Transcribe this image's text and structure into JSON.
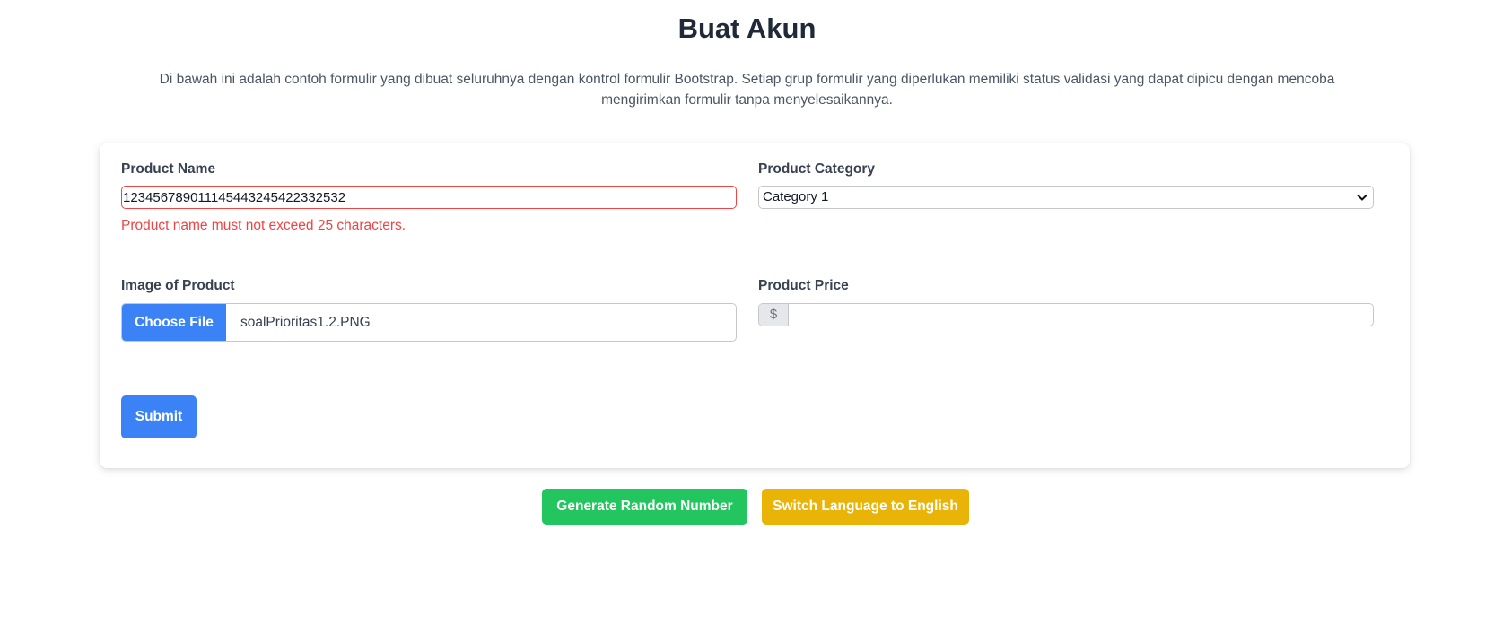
{
  "header": {
    "title": "Buat Akun",
    "description": "Di bawah ini adalah contoh formulir yang dibuat seluruhnya dengan kontrol formulir Bootstrap. Setiap grup formulir yang diperlukan memiliki status validasi yang dapat dipicu dengan mencoba mengirimkan formulir tanpa menyelesaikannya."
  },
  "form": {
    "product_name": {
      "label": "Product Name",
      "value": "12345678901114544324542233253​2",
      "error": "Product name must not exceed 25 characters."
    },
    "product_category": {
      "label": "Product Category",
      "selected": "Category 1"
    },
    "image": {
      "label": "Image of Product",
      "button_label": "Choose File",
      "file_name": "soalPrioritas1.2.PNG"
    },
    "price": {
      "label": "Product Price",
      "prefix": "$",
      "value": ""
    },
    "submit_label": "Submit"
  },
  "actions": {
    "generate_label": "Generate Random Number",
    "switch_language_label": "Switch Language to English"
  },
  "colors": {
    "primary": "#3b82f6",
    "success": "#22c55e",
    "warning": "#eab308",
    "danger": "#ef4444"
  },
  "icons": {
    "select_chevron": "chevron-down-icon"
  }
}
